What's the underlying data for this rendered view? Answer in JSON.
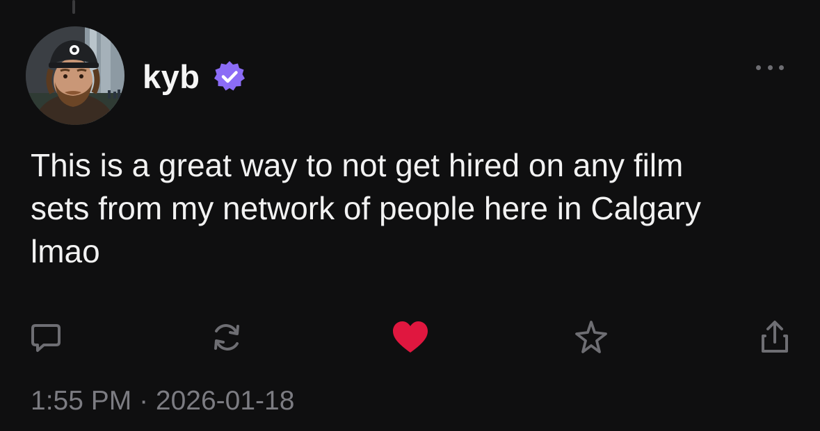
{
  "post": {
    "author": {
      "name": "kyb",
      "verified": true,
      "verified_color": "#8b6cf6"
    },
    "text": "This is a great way to not get hired on any film\nsets from my network of people here in Calgary\nlmao",
    "timestamp": "1:55 PM · 2026-01-18",
    "actions": [
      {
        "name": "reply",
        "icon": "comment-icon"
      },
      {
        "name": "repost",
        "icon": "repost-icon"
      },
      {
        "name": "like",
        "icon": "heart-icon",
        "active": true,
        "color": "#e0173f"
      },
      {
        "name": "bookmark",
        "icon": "sparkle-icon"
      },
      {
        "name": "share",
        "icon": "share-icon"
      }
    ],
    "more_icon": "more-icon"
  },
  "colors": {
    "background": "#0f0f10",
    "text": "#f2f2f2",
    "muted": "#7c7c82"
  }
}
